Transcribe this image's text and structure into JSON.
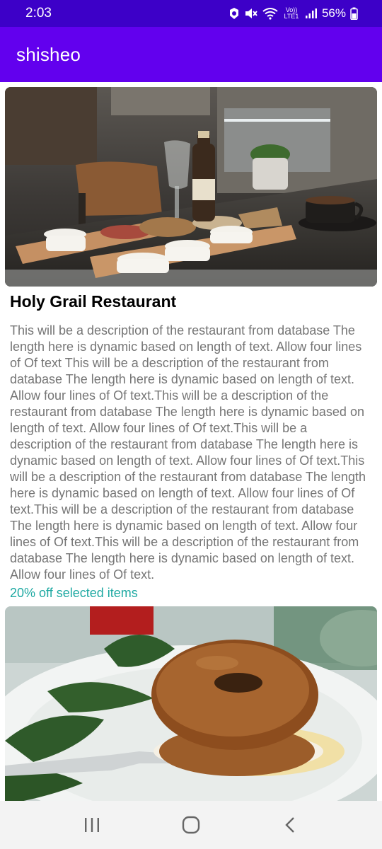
{
  "status_bar": {
    "time": "2:03",
    "battery_percent": "56%",
    "network_label": "Vo)) LTE1",
    "icons": [
      "data-saver-icon",
      "mute-icon",
      "wifi-icon",
      "signal-icon",
      "battery-icon"
    ]
  },
  "app_bar": {
    "title": "shisheo"
  },
  "restaurants": [
    {
      "image_icon": "restaurant-food-photo",
      "name": "Holy Grail Restaurant",
      "description": "This will be a description of the restaurant from database The length here is dynamic based on length of text. Allow four lines of Of text This will be a description of the restaurant from database The length here is dynamic based on length of text. Allow four lines of Of text.This will be a description of the restaurant from database The length here is dynamic based on length of text. Allow four lines of Of text.This will be a description of the restaurant from database The length here is dynamic based on length of text. Allow four lines of Of text.This will be a description of the restaurant from database The length here is dynamic based on length of text. Allow four lines of Of text.This will be a description of the restaurant from database The length here is dynamic based on length of text. Allow four lines of Of text.This will be a description of the restaurant from database The length here is dynamic based on length of text. Allow four lines of Of text.",
      "promo": "20% off selected items"
    },
    {
      "image_icon": "bagel-food-photo"
    }
  ],
  "nav_bar": {
    "buttons": [
      "recent-apps-icon",
      "home-icon",
      "back-icon"
    ]
  },
  "colors": {
    "status_bar": "#3d00c8",
    "app_bar": "#6200ee",
    "promo_text": "#1ea9a2",
    "description_text": "#757575"
  }
}
